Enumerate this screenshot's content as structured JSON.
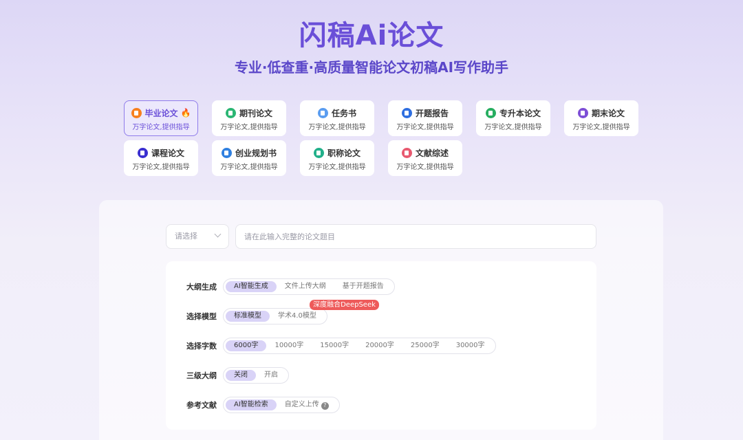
{
  "hero": {
    "logo": "闪稿Ai论文",
    "slogan": "专业·低查重·高质量智能论文初稿AI写作助手"
  },
  "cards": [
    {
      "title": "毕业论文",
      "sub": "万字论文,提供指导",
      "icon": "document-icon",
      "color": "#f7801f",
      "active": true,
      "badge": "fire-icon"
    },
    {
      "title": "期刊论文",
      "sub": "万字论文,提供指导",
      "icon": "document-icon",
      "color": "#2bb673"
    },
    {
      "title": "任务书",
      "sub": "万字论文,提供指导",
      "icon": "document-icon",
      "color": "#5b9df0"
    },
    {
      "title": "开题报告",
      "sub": "万字论文,提供指导",
      "icon": "document-icon",
      "color": "#2f6fe0"
    },
    {
      "title": "专升本论文",
      "sub": "万字论文,提供指导",
      "icon": "book-icon",
      "color": "#27ae60"
    },
    {
      "title": "期末论文",
      "sub": "万字论文,提供指导",
      "icon": "document-icon",
      "color": "#7e4fd6"
    },
    {
      "title": "课程论文",
      "sub": "万字论文,提供指导",
      "icon": "document-icon",
      "color": "#3a2fd0"
    },
    {
      "title": "创业规划书",
      "sub": "万字论文,提供指导",
      "icon": "document-icon",
      "color": "#2f80e0"
    },
    {
      "title": "职称论文",
      "sub": "万字论文,提供指导",
      "icon": "document-icon",
      "color": "#22b08a"
    },
    {
      "title": "文献综述",
      "sub": "万字论文,提供指导",
      "icon": "list-icon",
      "color": "#e85a70"
    }
  ],
  "form": {
    "select_value": "请选择",
    "title_placeholder": "请在此输入完整的论文题目"
  },
  "options": {
    "outline": {
      "label": "大纲生成",
      "items": [
        "AI智能生成",
        "文件上传大纲",
        "基于开题报告"
      ],
      "selected": 0
    },
    "model": {
      "label": "选择模型",
      "items": [
        "标准模型",
        "学术4.0模型"
      ],
      "selected": 0,
      "tag": "深度融合DeepSeek"
    },
    "words": {
      "label": "选择字数",
      "items": [
        "6000字",
        "10000字",
        "15000字",
        "20000字",
        "25000字",
        "30000字"
      ],
      "selected": 0
    },
    "level3": {
      "label": "三级大纲",
      "items": [
        "关闭",
        "开启"
      ],
      "selected": 0
    },
    "refs": {
      "label": "参考文献",
      "items": [
        "AI智能检索",
        "自定义上传"
      ],
      "selected": 0
    }
  }
}
